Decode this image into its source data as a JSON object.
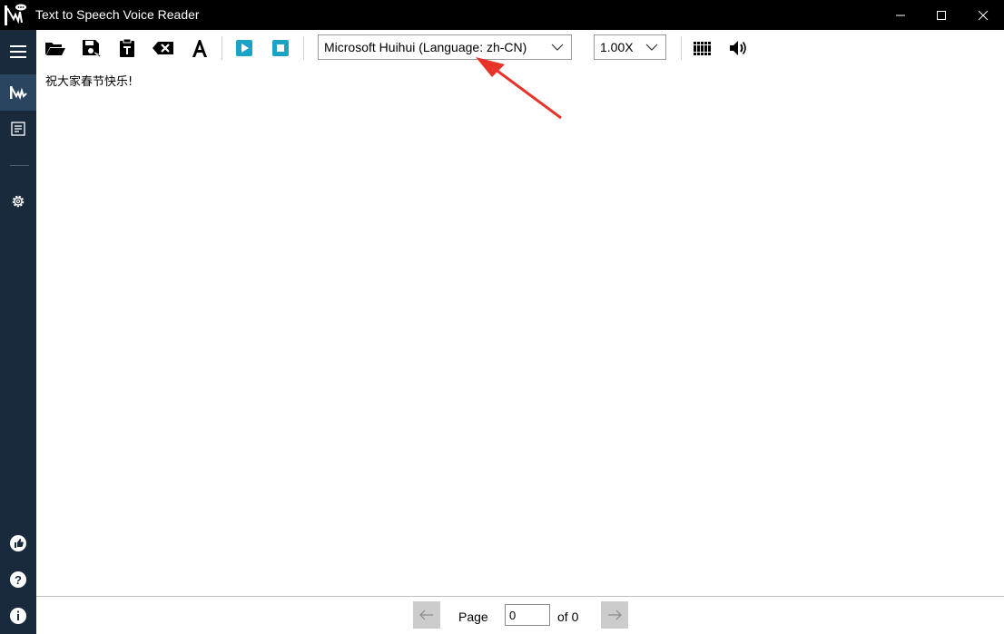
{
  "window": {
    "title": "Text to Speech Voice Reader",
    "controls": {
      "minimize": "minimize-icon",
      "maximize": "maximize-icon",
      "close": "close-icon"
    }
  },
  "sidebar": {
    "items": [
      {
        "icon": "hamburger-menu-icon"
      },
      {
        "icon": "text-to-speech-icon",
        "active": true
      },
      {
        "icon": "text-list-icon"
      },
      {
        "icon": "settings-gear-icon"
      },
      {
        "icon": "thumbs-up-icon"
      },
      {
        "icon": "help-icon"
      },
      {
        "icon": "info-icon"
      }
    ]
  },
  "toolbar": {
    "buttons": [
      "open-folder-icon",
      "save-as-icon",
      "paste-text-icon",
      "clear-text-icon",
      "font-icon",
      "play-icon",
      "stop-icon",
      "voices-library-icon",
      "volume-icon"
    ],
    "voice_select": "Microsoft Huihui (Language: zh-CN)",
    "speed_select": "1.00X"
  },
  "document": {
    "text": "祝大家春节快乐!"
  },
  "footer": {
    "page_label": "Page",
    "page_value": "0",
    "of_label": "of 0"
  },
  "colors": {
    "titlebar": "#000000",
    "sidebar": "#1a2a3d",
    "sidebar_active": "#2a4560",
    "accent": "#1aa3c4",
    "annotation_arrow": "#e8332b"
  }
}
